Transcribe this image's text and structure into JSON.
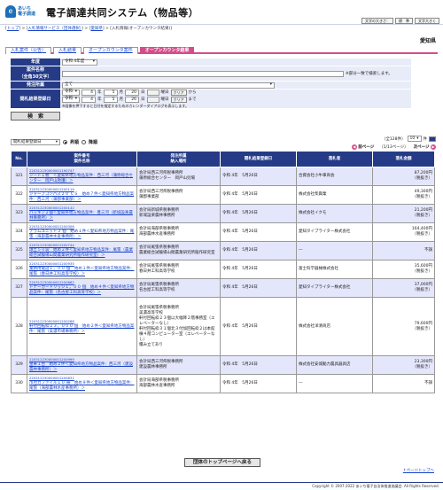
{
  "header": {
    "logo_mark": "e",
    "logo_line1": "あいち",
    "logo_line2": "電子調達",
    "title": "電子調達共同システム（物品等）",
    "font_buttons": [
      "文字の大きさ：",
      "標　準",
      "文字大きく"
    ]
  },
  "breadcrumb": {
    "items": [
      "トップ",
      "入札情報サービス（団体選択）",
      "愛知県"
    ],
    "current": "入札情報(オープンカウンタ結果)"
  },
  "region": "愛知県",
  "tabs": [
    "入札案件（公告）",
    "入札結果",
    "オープンカウンタ案件",
    "オープンカウンタ結果"
  ],
  "search": {
    "year_label": "年度",
    "year_value": "令和 4年度",
    "anken_label": "案件名称",
    "anken_sub": "（全角30文字）",
    "anken_note": "※部分一致で検索します。",
    "dept_label": "発注所属",
    "dept_value": "全て",
    "date_label": "開札結果登録日",
    "from": {
      "era": "令和",
      "y": "4",
      "m": "5",
      "d": "20",
      "calendar": "曜日",
      "clear": "クリア",
      "suffix": "から"
    },
    "to": {
      "era": "令和",
      "y": "4",
      "m": "5",
      "d": "26",
      "calendar": "曜日",
      "clear": "クリア",
      "suffix": "まで"
    },
    "unit_y": "年",
    "unit_m": "月",
    "unit_d": "日",
    "calendar_note": "※画像を押下すると日付を指定するためのカレンダーダイアログを表示します。",
    "button": "検　索"
  },
  "listbar": {
    "sort_value": "開札結果登録日",
    "asc": "昇順",
    "desc": "降順",
    "count": "（全128件）",
    "per_page": "10",
    "per_page_unit": "件",
    "prev": "前ページ",
    "range": "（1/13ページ）",
    "next": "次ページ"
  },
  "table": {
    "headers": [
      "No.",
      "案件番号\n案件名称",
      "発注所属\n納入場所",
      "開札結果登録日",
      "落札者",
      "落札金額"
    ],
    "rows": [
      {
        "no": "321",
        "code": "220312230000001190747",
        "name": "シート１枚　＜愛知県地方物品案件：西三河（蒲原総合センター　岡戸山救護）＞",
        "dept": "会計局西三河県税事務所\n蒲原総合センター　岡戸山児場",
        "date": "令和 4年　5月26日",
        "winner": "合資会社小牛車商会",
        "amount": "87,200円\n（税抜き）"
      },
      {
        "no": "322",
        "code": "220312230000001200119",
        "name": "シャープコンパス２０ ＣＳ　始め７件＜愛知県地方物品案件：西三河（蒲郡事業部）＞",
        "dept": "会計局西三河県税事務所\n蒲郡事業部",
        "date": "令和 4年　5月26日",
        "winner": "株式会社柴興業",
        "amount": "49,300円\n（税抜き）"
      },
      {
        "no": "323",
        "code": "220312230000001200142",
        "name": "パッキン２個＜愛知県地方物品案件：豊三河（新城設楽農林事務所）＞",
        "dept": "会計局新城県税事務所\n新城設楽農林事務所",
        "date": "令和 4年　5月26日",
        "winner": "株式会社イクモ",
        "amount": "21,200円\n（税抜き）"
      },
      {
        "no": "324",
        "code": "220312230000001200306",
        "name": "テラムユニット３ 個　始め１件＜愛知県地方物品案件：尾張（海部農林水産事務所）＞",
        "dept": "会計局海部県税事務所\n海部農林水産事務所",
        "date": "令和 4年　5月26日",
        "winner": "愛知タイプライター株式会社",
        "amount": "164,400円\n（税抜き）"
      },
      {
        "no": "325",
        "code": "220312230000001200744",
        "name": "球土５０袋　始め２件＜愛知県地方物品案件：尾張（農業総合試験場山間農業研究所稲作研究室）＞",
        "dept": "会計局尾張県税事務所\n農業総合試験場山間農業研究所稲作研究室",
        "date": "令和 4年　5月26日",
        "winner": "―",
        "amount": "不調"
      },
      {
        "no": "326",
        "code": "220312230000001200935",
        "name": "業務用電話１，００ 個　始め１件＜愛知県地方物品案件：尾張（春日井工科高等学校）＞",
        "dept": "会計局尾張県税事務所\n春日井工科高等学校",
        "date": "令和 4年　5月26日",
        "winner": "富士科学器械株式会社",
        "amount": "35,600円\n（税抜き）"
      },
      {
        "no": "327",
        "code": "220312230000001200862",
        "name": "トナーカートリッジ１，００ 個　始め４件＜愛知県地方物品案件：尾張（名古屋工科高等学校）＞",
        "dept": "会計局尾張県税事務所\n名古屋工科高等学校",
        "date": "令和 4年　5月26日",
        "winner": "愛知タイプライター株式会社",
        "amount": "37,000円\n（税抜き）"
      },
      {
        "no": "328",
        "code": "220312230000001200268",
        "name": "軒付回転枠２３，０００ 個　始め２件＜愛知県地方物品案件：尾張（美濃市場事務所）＞",
        "dept": "会計局尾張県税事務所\n美濃高等学校\n軒付回転枠２３個以大幅降２階事務室（エレベーターなし）\n軒付回転枠３１個北３付加回転枠２は本館棟４階コンピューター室（エレベーターなし）\n積み立てあり",
        "date": "令和 4年　5月26日",
        "winner": "株式会社洋清商店",
        "amount": "79,600円\n（税抜き）"
      },
      {
        "no": "329",
        "code": "220312230000001200999",
        "name": "金華１台　始め２件＜愛知県地方物品案件：西三河（建設農林事務所）＞",
        "dept": "会計局西三河県税事務所\n建設農林事務所",
        "date": "令和 4年　5月26日",
        "winner": "株式会社安城動力農具器具店",
        "amount": "23,300円\n（税抜き）"
      },
      {
        "no": "330",
        "code": "220312230000001200831",
        "name": "市付カファイル１０ 冊　始め９件＜愛知県地方物品案件：尾張（海部農林水産事務所）＞",
        "dept": "会計局海部県税事務所\n海部農林水産事務所",
        "date": "令和 4年　5月26日",
        "winner": "―",
        "amount": "不調"
      }
    ]
  },
  "footer": {
    "back_button": "団体のトップページへ戻る",
    "page_top": "↑ページトップへ",
    "copyright": "Copyright © 2007-2022 あいち電子自治体推進協議会. All Rights Reserved."
  },
  "colors": {
    "navy": "#253b87",
    "pink": "#d64b8a",
    "lavender": "#e4e6fb"
  }
}
